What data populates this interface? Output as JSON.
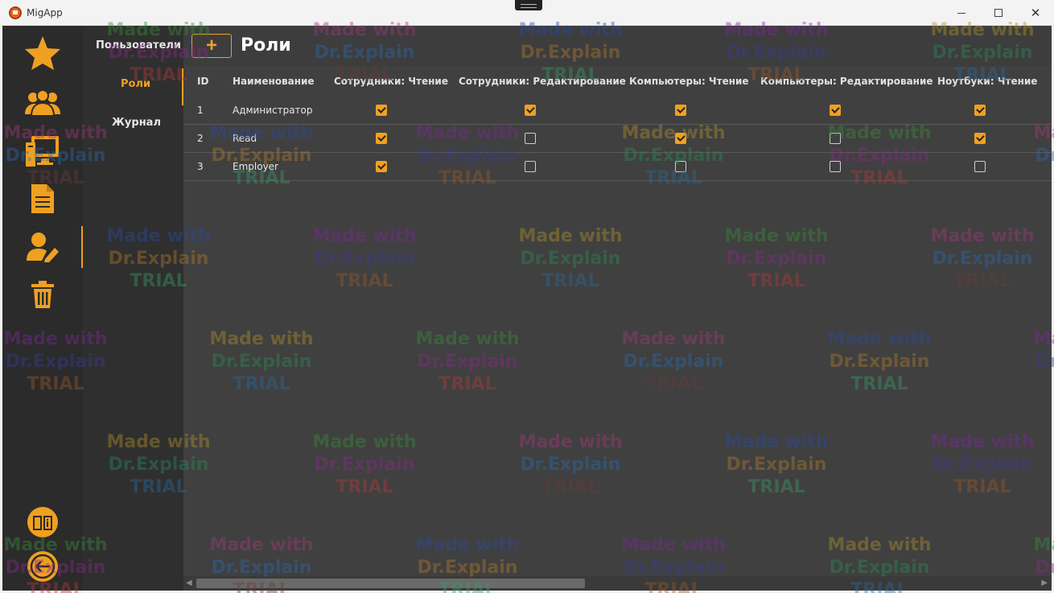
{
  "window": {
    "title": "MigApp",
    "minimize_glyph": "—",
    "maximize_glyph": "☐",
    "close_glyph": "✕"
  },
  "rail": {
    "items": [
      {
        "icon": "star-icon",
        "active": false
      },
      {
        "icon": "users-icon",
        "active": false
      },
      {
        "icon": "computer-icon",
        "active": false
      },
      {
        "icon": "document-icon",
        "active": false
      },
      {
        "icon": "user-edit-icon",
        "active": true
      },
      {
        "icon": "trash-icon",
        "active": false
      }
    ],
    "bottom": [
      {
        "icon": "help-book-icon"
      },
      {
        "icon": "logout-icon"
      }
    ],
    "accent": "#f0a020"
  },
  "subnav": {
    "items": [
      {
        "label": "Пользователи",
        "active": false
      },
      {
        "label": "Роли",
        "active": true
      },
      {
        "label": "Журнал",
        "active": false
      }
    ]
  },
  "header": {
    "add_label": "+",
    "title": "Роли"
  },
  "table": {
    "columns": [
      "ID",
      "Наименование",
      "Сотрудники: Чтение",
      "Сотрудники: Редактирование",
      "Компьютеры: Чтение",
      "Компьютеры: Редактирование",
      "Ноутбуки: Чтение"
    ],
    "rows": [
      {
        "id": "1",
        "name": "Администратор",
        "perms": [
          true,
          true,
          true,
          true,
          true
        ]
      },
      {
        "id": "2",
        "name": "Read",
        "perms": [
          true,
          false,
          true,
          false,
          true
        ]
      },
      {
        "id": "3",
        "name": "Employer",
        "perms": [
          true,
          false,
          false,
          false,
          false
        ]
      }
    ]
  },
  "watermark": {
    "line1": "Made with",
    "line2": "Dr.Explain",
    "line3": "TRIAL"
  },
  "scroll": {
    "left_arrow": "◀",
    "right_arrow": "▶"
  }
}
